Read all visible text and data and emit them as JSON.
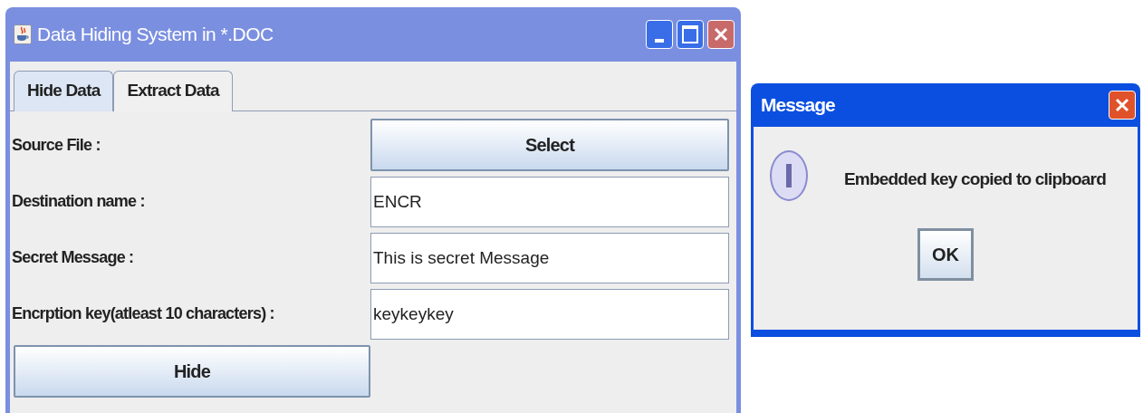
{
  "window": {
    "title": "Data Hiding System in *.DOC"
  },
  "tabs": [
    {
      "label": "Hide Data",
      "selected": true
    },
    {
      "label": "Extract Data",
      "selected": false
    }
  ],
  "form": {
    "rows": [
      {
        "label": "Source File :",
        "kind": "button",
        "value": "Select"
      },
      {
        "label": "Destination name :",
        "kind": "field",
        "value": "ENCR"
      },
      {
        "label": "Secret Message :",
        "kind": "field",
        "value": "This is secret Message"
      },
      {
        "label": "Encrption key(atleast 10 characters) :",
        "kind": "field",
        "value": "keykeykey"
      }
    ],
    "action_button": "Hide"
  },
  "dialog": {
    "title": "Message",
    "message": "Embedded key copied to clipboard",
    "button": "OK"
  }
}
